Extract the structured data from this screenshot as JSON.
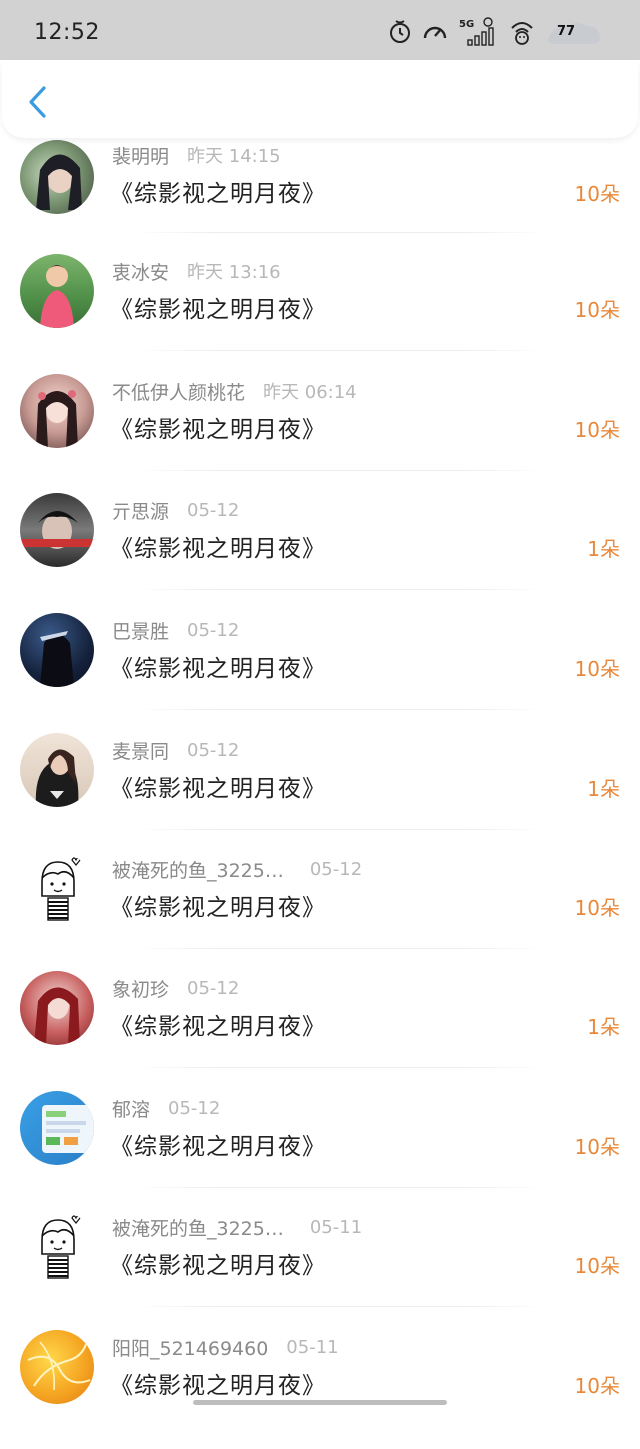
{
  "status_bar": {
    "time": "12:52",
    "network": "5G",
    "battery": "77",
    "icons": [
      "alarm-icon",
      "speed-icon",
      "signal-5g-icon",
      "wifi-icon",
      "battery-icon"
    ]
  },
  "header": {
    "back_icon": "chevron-left-icon"
  },
  "colors": {
    "accent": "#3a9be0",
    "amount": "#e8883a",
    "name": "#8a8a8a",
    "time": "#b8b8b8"
  },
  "items": [
    {
      "name": "裴明明",
      "time": "昨天 14:15",
      "title": "《综影视之明月夜》",
      "amount": "10朵"
    },
    {
      "name": "衷冰安",
      "time": "昨天 13:16",
      "title": "《综影视之明月夜》",
      "amount": "10朵"
    },
    {
      "name": "不低伊人颜桃花",
      "time": "昨天 06:14",
      "title": "《综影视之明月夜》",
      "amount": "10朵"
    },
    {
      "name": "亓思源",
      "time": "05-12",
      "title": "《综影视之明月夜》",
      "amount": "1朵"
    },
    {
      "name": "巴景胜",
      "time": "05-12",
      "title": "《综影视之明月夜》",
      "amount": "10朵"
    },
    {
      "name": "麦景同",
      "time": "05-12",
      "title": "《综影视之明月夜》",
      "amount": "1朵"
    },
    {
      "name": "被淹死的鱼_3225…",
      "time": "05-12",
      "title": "《综影视之明月夜》",
      "amount": "10朵"
    },
    {
      "name": "象初珍",
      "time": "05-12",
      "title": "《综影视之明月夜》",
      "amount": "1朵"
    },
    {
      "name": "郁溶",
      "time": "05-12",
      "title": "《综影视之明月夜》",
      "amount": "10朵"
    },
    {
      "name": "被淹死的鱼_3225…",
      "time": "05-11",
      "title": "《综影视之明月夜》",
      "amount": "10朵"
    },
    {
      "name": "阳阳_521469460",
      "time": "05-11",
      "title": "《综影视之明月夜》",
      "amount": "10朵"
    }
  ]
}
